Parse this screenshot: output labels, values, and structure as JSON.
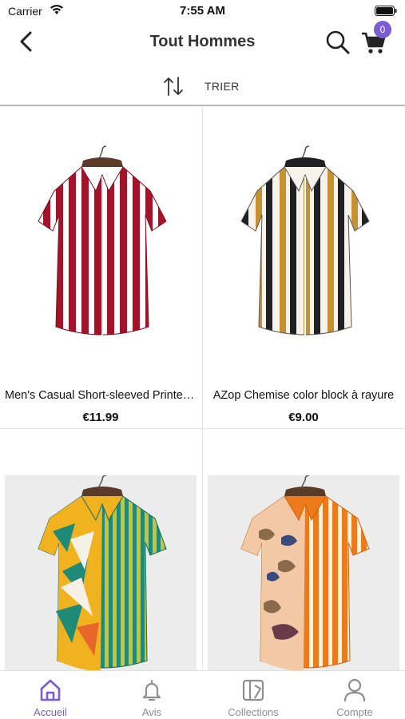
{
  "status_bar": {
    "carrier": "Carrier",
    "time": "7:55 AM"
  },
  "nav": {
    "title": "Tout Hommes",
    "cart_count": "0"
  },
  "sort": {
    "label": "TRIER"
  },
  "products": [
    {
      "name": "Men's Casual Short-sleeved Printed Shirt",
      "price": "€11.99",
      "colors": [
        "#a3142a",
        "#ffffff"
      ]
    },
    {
      "name": "AZop Chemise color block à rayure",
      "price": "€9.00",
      "colors": [
        "#c8912f",
        "#1f1f24",
        "#f7f3ea"
      ]
    },
    {
      "name": "",
      "price": "",
      "colors": [
        "#f0b21f",
        "#1f8a76",
        "#c7c33a"
      ]
    },
    {
      "name": "",
      "price": "",
      "colors": [
        "#f2c9a4",
        "#ef7a1c",
        "#fbf3e4"
      ]
    }
  ],
  "tabs": [
    {
      "label": "Accueil",
      "icon": "home-icon",
      "active": true
    },
    {
      "label": "Avis",
      "icon": "bell-icon",
      "active": false
    },
    {
      "label": "Collections",
      "icon": "collections-icon",
      "active": false
    },
    {
      "label": "Compte",
      "icon": "person-icon",
      "active": false
    }
  ],
  "colors": {
    "accent": "#7c5cd6",
    "inactive": "#8e8e93"
  }
}
